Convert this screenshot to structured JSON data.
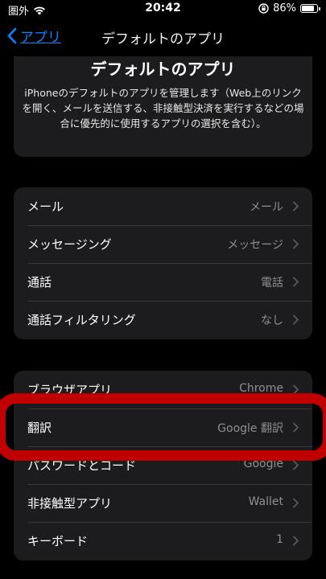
{
  "status_bar": {
    "carrier": "圏外",
    "time": "20:42",
    "battery": "86%",
    "battery_level": 0.86
  },
  "nav": {
    "back_label": "アプリ",
    "title": "デフォルトのアプリ"
  },
  "header": {
    "title": "デフォルトのアプリ",
    "description": "iPhoneのデフォルトのアプリを管理します（Web上のリンクを開く、メールを送信する、非接触型決済を実行するなどの場合に優先的に使用するアプリの選択を含む）。"
  },
  "groups": [
    {
      "rows": [
        {
          "label": "メール",
          "value": "メール"
        },
        {
          "label": "メッセージング",
          "value": "メッセージ"
        },
        {
          "label": "通話",
          "value": "電話"
        },
        {
          "label": "通話フィルタリング",
          "value": "なし"
        }
      ]
    },
    {
      "rows": [
        {
          "label": "ブラウザアプリ",
          "value": "Chrome"
        },
        {
          "label": "翻訳",
          "value": "Google 翻訳"
        },
        {
          "label": "パスワードとコード",
          "value": "Google"
        },
        {
          "label": "非接触型アプリ",
          "value": "Wallet"
        },
        {
          "label": "キーボード",
          "value": "1"
        }
      ]
    }
  ],
  "colors": {
    "accent": "#0a84ff",
    "highlight": "#c00000"
  },
  "icons": [
    "wifi-icon",
    "orientation-lock-icon",
    "battery-icon",
    "chevron-left-icon",
    "chevron-right-icon"
  ]
}
